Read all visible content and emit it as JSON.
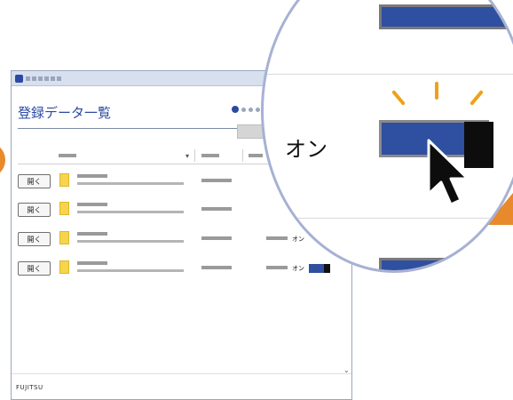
{
  "window": {
    "title": "登録データ一覧",
    "logo": "FUJITSU"
  },
  "rows": [
    {
      "button_label": "開く",
      "toggle_label": ""
    },
    {
      "button_label": "開く",
      "toggle_label": ""
    },
    {
      "button_label": "開く",
      "toggle_label": "オン"
    },
    {
      "button_label": "開く",
      "toggle_label": "オン"
    }
  ],
  "magnifier": {
    "toggle_label": "オン"
  },
  "colors": {
    "accent": "#2b4aa3",
    "toggle_on": "#2f4fa0",
    "highlight": "#e8892b",
    "file_icon": "#f6d44c"
  },
  "icons": {
    "app": "app-icon",
    "file": "file-icon",
    "cursor": "mouse-pointer-icon",
    "sort": "chevron-down-icon"
  }
}
